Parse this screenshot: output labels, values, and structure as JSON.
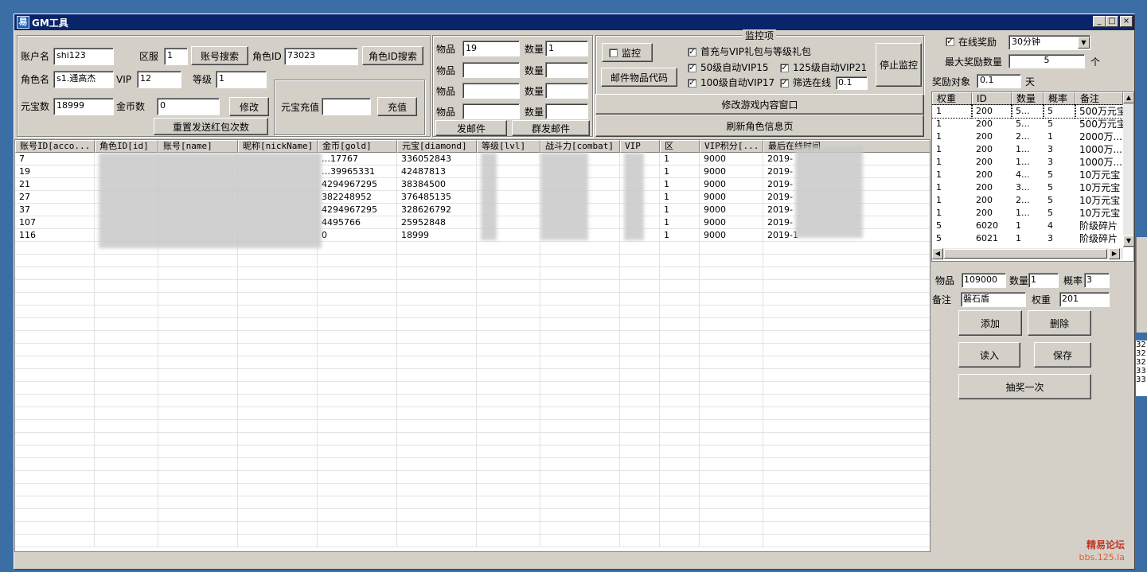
{
  "window": {
    "title": "GM工具",
    "icon_glyph": "易",
    "minimize": "_",
    "maximize": "□",
    "close": "×"
  },
  "account": {
    "account_label": "账户名",
    "account_value": "shi123",
    "zone_label": "区服",
    "zone_value": "1",
    "search_account_btn": "账号搜索",
    "role_id_label": "角色ID",
    "role_id_value": "73023",
    "search_role_btn": "角色ID搜索",
    "role_name_label": "角色名",
    "role_name_value": "s1.通高杰",
    "vip_label": "VIP",
    "vip_value": "12",
    "level_label": "等级",
    "level_value": "1",
    "yuanbao_label": "元宝数",
    "yuanbao_value": "18999",
    "gold_label": "金币数",
    "gold_value": "0",
    "modify_btn": "修改",
    "reset_redpack_btn": "重置发送红包次数",
    "recharge_label": "元宝充值",
    "recharge_value": "",
    "recharge_btn": "充值"
  },
  "mail": {
    "item_label": "物品",
    "qty_label": "数量",
    "rows": [
      {
        "item": "19",
        "qty": "1"
      },
      {
        "item": "",
        "qty": ""
      },
      {
        "item": "",
        "qty": ""
      },
      {
        "item": "",
        "qty": ""
      }
    ],
    "send_btn": "发邮件",
    "mass_send_btn": "群发邮件"
  },
  "monitor": {
    "group_title": "监控项",
    "monitor_chk": "监控",
    "monitor_checked": false,
    "mail_code_btn": "邮件物品代码",
    "stop_btn": "停止监控",
    "opt1": "首充与VIP礼包与等级礼包",
    "opt2": "50级自动VIP15",
    "opt3": "125级自动VIP21",
    "opt4": "100级自动VIP17",
    "opt5": "筛选在线",
    "filter_value": "0.1",
    "modify_window_btn": "修改游戏内容窗口",
    "refresh_btn": "刷新角色信息页"
  },
  "main_table": {
    "headers": [
      "账号ID[acco...",
      "角色ID[id]",
      "账号[name]",
      "昵称[nickName]",
      "金币[gold]",
      "元宝[diamond]",
      "等级[lvl]",
      "战斗力[combat]",
      "VIP",
      "区",
      "VIP积分[...",
      "最后在线时间"
    ],
    "rows": [
      [
        "7",
        "",
        "",
        "",
        "…17767",
        "336052843",
        "",
        "",
        "",
        "1",
        "9000",
        "2019-"
      ],
      [
        "19",
        "",
        "",
        "",
        "…39965331",
        "42487813",
        "",
        "",
        "",
        "1",
        "9000",
        "2019-"
      ],
      [
        "21",
        "",
        "",
        "",
        "4294967295",
        "38384500",
        "",
        "",
        "",
        "1",
        "9000",
        "2019-"
      ],
      [
        "27",
        "",
        "",
        "",
        "382248952",
        "376485135",
        "",
        "",
        "",
        "1",
        "9000",
        "2019-"
      ],
      [
        "37",
        "",
        "",
        "",
        "4294967295",
        "328626792",
        "",
        "",
        "",
        "1",
        "9000",
        "2019-"
      ],
      [
        "107",
        "",
        "",
        "",
        "4495766",
        "25952848",
        "",
        "",
        "",
        "1",
        "9000",
        "2019-"
      ],
      [
        "116",
        "",
        "",
        "",
        "0",
        "18999",
        "",
        "",
        "",
        "1",
        "9000",
        "2019-1"
      ]
    ]
  },
  "reward": {
    "online_chk": "在线奖励",
    "online_checked": true,
    "interval_value": "30分钟",
    "max_label": "最大奖励数量",
    "max_value": "5",
    "max_unit": "个",
    "target_label": "奖励对象",
    "target_value": "0.1",
    "target_unit": "天",
    "headers": [
      "权重",
      "ID",
      "数量",
      "概率",
      "备注"
    ],
    "rows": [
      [
        "1",
        "200",
        "5...",
        "5",
        "500万元宝"
      ],
      [
        "1",
        "200",
        "5...",
        "5",
        "500万元宝"
      ],
      [
        "1",
        "200",
        "2...",
        "1",
        "2000万..."
      ],
      [
        "1",
        "200",
        "1...",
        "3",
        "1000万..."
      ],
      [
        "1",
        "200",
        "1...",
        "3",
        "1000万..."
      ],
      [
        "1",
        "200",
        "4...",
        "5",
        "10万元宝"
      ],
      [
        "1",
        "200",
        "3...",
        "5",
        "10万元宝"
      ],
      [
        "1",
        "200",
        "2...",
        "5",
        "10万元宝"
      ],
      [
        "1",
        "200",
        "1...",
        "5",
        "10万元宝"
      ],
      [
        "5",
        "6020",
        "1",
        "4",
        "阶级碎片"
      ],
      [
        "5",
        "6021",
        "1",
        "3",
        "阶级碎片"
      ]
    ],
    "item_label": "物品",
    "item_value": "109000",
    "qty_label": "数量",
    "qty_value": "1",
    "prob_label": "概率",
    "prob_value": "3",
    "note_label": "备注",
    "note_value": "磐石盾",
    "weight_label": "权重",
    "weight_value": "201",
    "add_btn": "添加",
    "delete_btn": "删除",
    "read_btn": "读入",
    "save_btn": "保存",
    "draw_btn": "抽奖一次"
  },
  "background_edge": [
    "32",
    "32",
    "32",
    "33",
    "33"
  ],
  "watermark": {
    "line1": "精易论坛",
    "line2": "bbs.125.la"
  }
}
